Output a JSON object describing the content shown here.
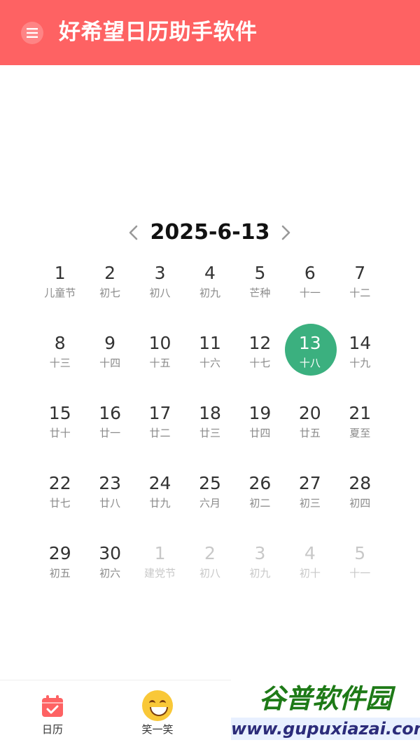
{
  "header": {
    "title": "好希望日历助手软件",
    "menu_icon": "hamburger-icon"
  },
  "date_nav": {
    "current": "2025-6-13",
    "prev_icon": "chevron-left-icon",
    "next_icon": "chevron-right-icon"
  },
  "calendar": {
    "selected_color": "#3bb07f",
    "weeks": [
      [
        {
          "day": "1",
          "lunar": "儿童节"
        },
        {
          "day": "2",
          "lunar": "初七"
        },
        {
          "day": "3",
          "lunar": "初八"
        },
        {
          "day": "4",
          "lunar": "初九"
        },
        {
          "day": "5",
          "lunar": "芒种"
        },
        {
          "day": "6",
          "lunar": "十一"
        },
        {
          "day": "7",
          "lunar": "十二"
        }
      ],
      [
        {
          "day": "8",
          "lunar": "十三"
        },
        {
          "day": "9",
          "lunar": "十四"
        },
        {
          "day": "10",
          "lunar": "十五"
        },
        {
          "day": "11",
          "lunar": "十六"
        },
        {
          "day": "12",
          "lunar": "十七"
        },
        {
          "day": "13",
          "lunar": "十八",
          "selected": true
        },
        {
          "day": "14",
          "lunar": "十九"
        }
      ],
      [
        {
          "day": "15",
          "lunar": "廿十"
        },
        {
          "day": "16",
          "lunar": "廿一"
        },
        {
          "day": "17",
          "lunar": "廿二"
        },
        {
          "day": "18",
          "lunar": "廿三"
        },
        {
          "day": "19",
          "lunar": "廿四"
        },
        {
          "day": "20",
          "lunar": "廿五"
        },
        {
          "day": "21",
          "lunar": "夏至"
        }
      ],
      [
        {
          "day": "22",
          "lunar": "廿七"
        },
        {
          "day": "23",
          "lunar": "廿八"
        },
        {
          "day": "24",
          "lunar": "廿九"
        },
        {
          "day": "25",
          "lunar": "六月"
        },
        {
          "day": "26",
          "lunar": "初二"
        },
        {
          "day": "27",
          "lunar": "初三"
        },
        {
          "day": "28",
          "lunar": "初四"
        }
      ],
      [
        {
          "day": "29",
          "lunar": "初五"
        },
        {
          "day": "30",
          "lunar": "初六"
        },
        {
          "day": "1",
          "lunar": "建党节",
          "other": true
        },
        {
          "day": "2",
          "lunar": "初八",
          "other": true
        },
        {
          "day": "3",
          "lunar": "初九",
          "other": true
        },
        {
          "day": "4",
          "lunar": "初十",
          "other": true
        },
        {
          "day": "5",
          "lunar": "十一",
          "other": true
        }
      ]
    ]
  },
  "bottom_nav": {
    "tabs": [
      {
        "label": "日历",
        "icon": "calendar-check-icon",
        "color": "#fe6263"
      },
      {
        "label": "笑一笑",
        "icon": "laughing-face-icon"
      }
    ]
  },
  "watermark": {
    "line1": "谷普软件园",
    "line2": "www.gupuxiazai.com"
  }
}
